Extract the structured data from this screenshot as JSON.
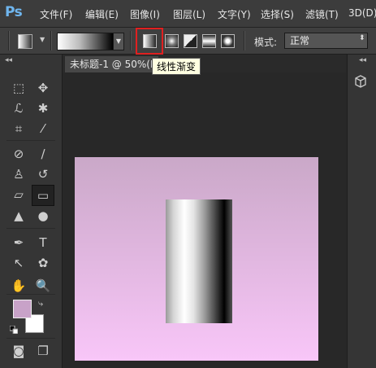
{
  "app": {
    "logo": "Ps"
  },
  "menu": [
    "文件(F)",
    "编辑(E)",
    "图像(I)",
    "图层(L)",
    "文字(Y)",
    "选择(S)",
    "滤镜(T)",
    "3D(D)"
  ],
  "options_bar": {
    "tooltip": "线性渐变",
    "mode_label": "模式:",
    "mode_value": "正常"
  },
  "document": {
    "tab_title": "未标题-1 @ 50%(R"
  },
  "toolbox_collapse": "◂◂",
  "right_collapse": "◂◂",
  "colors": {
    "foreground": "#c8a2c8",
    "background": "#ffffff",
    "accent_highlight": "#e02020",
    "canvas_top": "#caa8c8",
    "canvas_bottom": "#f8c6f8"
  },
  "tools": [
    {
      "name": "rect-marquee-tool-icon",
      "glyph": "⬚"
    },
    {
      "name": "move-tool-icon",
      "glyph": "✥"
    },
    {
      "name": "lasso-tool-icon",
      "glyph": "ℒ"
    },
    {
      "name": "magic-wand-tool-icon",
      "glyph": "✱"
    },
    {
      "name": "crop-tool-icon",
      "glyph": "⌗"
    },
    {
      "name": "eyedropper-tool-icon",
      "glyph": "⁄"
    },
    {
      "name": "healing-brush-tool-icon",
      "glyph": "⊘"
    },
    {
      "name": "brush-tool-icon",
      "glyph": "∕"
    },
    {
      "name": "clone-stamp-tool-icon",
      "glyph": "♙"
    },
    {
      "name": "history-brush-tool-icon",
      "glyph": "↺"
    },
    {
      "name": "eraser-tool-icon",
      "glyph": "▱"
    },
    {
      "name": "gradient-tool-icon",
      "glyph": "▭"
    },
    {
      "name": "blur-tool-icon",
      "glyph": "▲"
    },
    {
      "name": "dodge-tool-icon",
      "glyph": "●"
    },
    {
      "name": "pen-tool-icon",
      "glyph": "✒"
    },
    {
      "name": "type-tool-icon",
      "glyph": "T"
    },
    {
      "name": "path-selection-tool-icon",
      "glyph": "↖"
    },
    {
      "name": "custom-shape-tool-icon",
      "glyph": "✿"
    },
    {
      "name": "hand-tool-icon",
      "glyph": "✋"
    },
    {
      "name": "zoom-tool-icon",
      "glyph": "🔍"
    }
  ],
  "bottom_tools": [
    {
      "name": "quick-mask-icon",
      "glyph": "◙"
    },
    {
      "name": "screen-mode-icon",
      "glyph": "❐"
    }
  ]
}
